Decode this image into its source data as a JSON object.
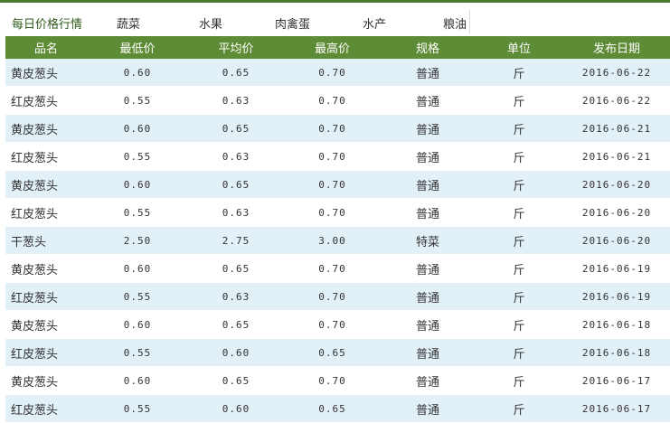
{
  "tabs": {
    "title": "每日价格行情",
    "items": [
      "蔬菜",
      "水果",
      "肉禽蛋",
      "水产",
      "粮油"
    ]
  },
  "table": {
    "headers": [
      "品名",
      "最低价",
      "平均价",
      "最高价",
      "规格",
      "单位",
      "发布日期"
    ],
    "rows": [
      [
        "黄皮葱头",
        "0.60",
        "0.65",
        "0.70",
        "普通",
        "斤",
        "2016-06-22"
      ],
      [
        "红皮葱头",
        "0.55",
        "0.63",
        "0.70",
        "普通",
        "斤",
        "2016-06-22"
      ],
      [
        "黄皮葱头",
        "0.60",
        "0.65",
        "0.70",
        "普通",
        "斤",
        "2016-06-21"
      ],
      [
        "红皮葱头",
        "0.55",
        "0.63",
        "0.70",
        "普通",
        "斤",
        "2016-06-21"
      ],
      [
        "黄皮葱头",
        "0.60",
        "0.65",
        "0.70",
        "普通",
        "斤",
        "2016-06-20"
      ],
      [
        "红皮葱头",
        "0.55",
        "0.63",
        "0.70",
        "普通",
        "斤",
        "2016-06-20"
      ],
      [
        "干葱头",
        "2.50",
        "2.75",
        "3.00",
        "特菜",
        "斤",
        "2016-06-20"
      ],
      [
        "黄皮葱头",
        "0.60",
        "0.65",
        "0.70",
        "普通",
        "斤",
        "2016-06-19"
      ],
      [
        "红皮葱头",
        "0.55",
        "0.63",
        "0.70",
        "普通",
        "斤",
        "2016-06-19"
      ],
      [
        "黄皮葱头",
        "0.60",
        "0.65",
        "0.70",
        "普通",
        "斤",
        "2016-06-18"
      ],
      [
        "红皮葱头",
        "0.55",
        "0.60",
        "0.65",
        "普通",
        "斤",
        "2016-06-18"
      ],
      [
        "黄皮葱头",
        "0.60",
        "0.65",
        "0.70",
        "普通",
        "斤",
        "2016-06-17"
      ],
      [
        "红皮葱头",
        "0.55",
        "0.60",
        "0.65",
        "普通",
        "斤",
        "2016-06-17"
      ]
    ]
  },
  "colors": {
    "accent": "#4a7a2c",
    "header_bg": "#5e8b35",
    "row_alt_bg": "#e2f0f8"
  }
}
